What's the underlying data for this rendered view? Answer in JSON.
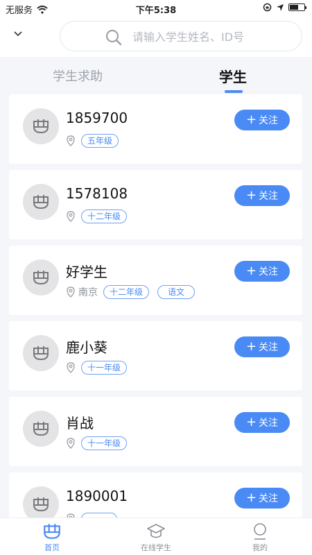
{
  "status_bar": {
    "carrier": "无服务",
    "time": "下午5:38"
  },
  "search": {
    "placeholder": "请输入学生姓名、ID号",
    "value": ""
  },
  "tabs": [
    {
      "label": "学生求助",
      "active": false
    },
    {
      "label": "学生",
      "active": true
    }
  ],
  "students": [
    {
      "name": "1859700",
      "city": "",
      "tags": [
        "五年级"
      ],
      "follow_label": "关注"
    },
    {
      "name": "1578108",
      "city": "",
      "tags": [
        "十二年级"
      ],
      "follow_label": "关注"
    },
    {
      "name": "好学生",
      "city": "南京",
      "tags": [
        "十二年级",
        "语文"
      ],
      "follow_label": "关注"
    },
    {
      "name": "鹿小葵",
      "city": "",
      "tags": [
        "十一年级"
      ],
      "follow_label": "关注"
    },
    {
      "name": "肖战",
      "city": "",
      "tags": [
        "十一年级"
      ],
      "follow_label": "关注"
    },
    {
      "name": "1890001",
      "city": "",
      "tags": [
        ""
      ],
      "follow_label": "关注"
    }
  ],
  "bottom_nav": [
    {
      "label": "首页",
      "icon": "home-icon",
      "active": true
    },
    {
      "label": "在线学生",
      "icon": "graduation-cap-icon",
      "active": false
    },
    {
      "label": "我的",
      "icon": "user-icon",
      "active": false
    }
  ],
  "colors": {
    "accent": "#4a8af4",
    "background": "#f4f6fa",
    "avatar_bg": "#e4e4e6"
  }
}
